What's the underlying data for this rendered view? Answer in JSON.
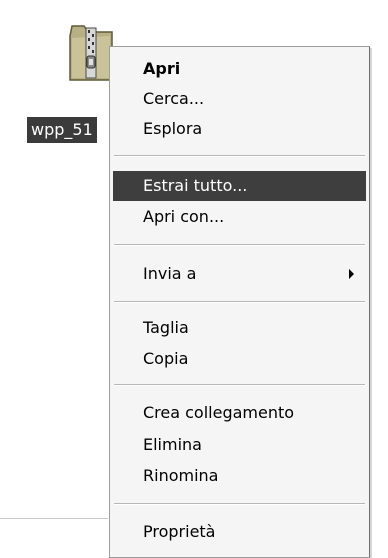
{
  "desktop": {
    "file_label": "wpp_51",
    "file_icon": "zip-folder-icon"
  },
  "context_menu": {
    "items": [
      {
        "label": "Apri"
      },
      {
        "label": "Cerca..."
      },
      {
        "label": "Esplora"
      },
      {
        "label": "Estrai tutto..."
      },
      {
        "label": "Apri con..."
      },
      {
        "label": "Invia a"
      },
      {
        "label": "Taglia"
      },
      {
        "label": "Copia"
      },
      {
        "label": "Crea collegamento"
      },
      {
        "label": "Elimina"
      },
      {
        "label": "Rinomina"
      },
      {
        "label": "Proprietà"
      }
    ],
    "highlighted_item": "Estrai tutto...",
    "default_item": "Apri",
    "submenu_arrow_icon": "chevron-right-icon"
  },
  "colors": {
    "highlight": "#3e3e3e",
    "menu_background": "#f5f5f5",
    "selection_label_background": "#3b3b3b"
  }
}
